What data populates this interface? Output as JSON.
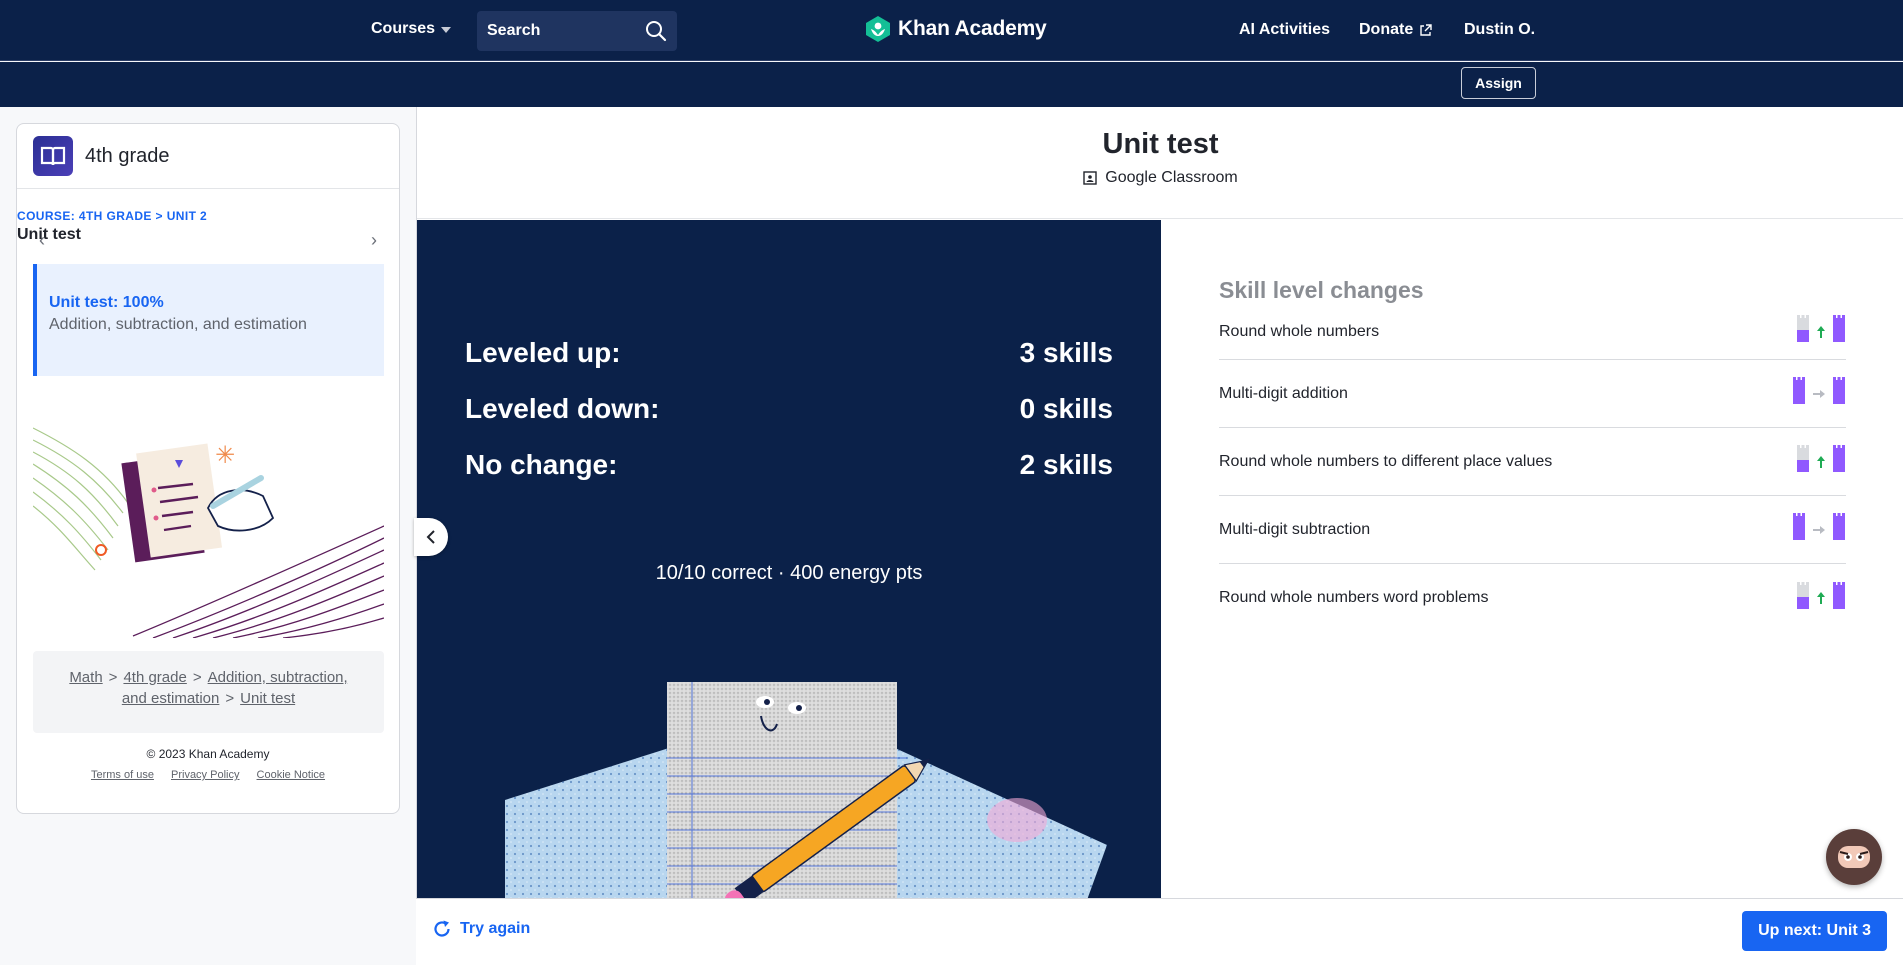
{
  "nav": {
    "courses_label": "Courses",
    "search_placeholder": "Search",
    "logo_text": "Khan Academy",
    "ai_label": "AI Activities",
    "donate_label": "Donate",
    "user_label": "Dustin O.",
    "assign_label": "Assign"
  },
  "sidebar": {
    "course_title": "4th grade",
    "crumb_course": "COURSE: 4TH GRADE",
    "crumb_sep": ">",
    "crumb_unit": "UNIT 2",
    "unit_name": "Unit test",
    "active_item": {
      "title": "Unit test: 100%",
      "subtitle": "Addition, subtraction, and estimation"
    },
    "breadcrumb": [
      "Math",
      "4th grade",
      "Addition, subtraction,",
      "and estimation",
      "Unit test"
    ],
    "breadcrumb_sep": ">",
    "copyright": "© 2023 Khan Academy",
    "footer_links": [
      "Terms of use",
      "Privacy Policy",
      "Cookie Notice"
    ]
  },
  "main": {
    "title": "Unit test",
    "google_classroom": "Google Classroom",
    "stats": [
      {
        "label": "Leveled up:",
        "value": "3 skills"
      },
      {
        "label": "Leveled down:",
        "value": "0 skills"
      },
      {
        "label": "No change:",
        "value": "2 skills"
      }
    ],
    "summary": "10/10 correct · 400 energy pts",
    "skills_title": "Skill level changes",
    "skills": [
      {
        "name": "Round whole numbers",
        "change": "up"
      },
      {
        "name": "Multi-digit addition",
        "change": "same"
      },
      {
        "name": "Round whole numbers to different place values",
        "change": "up"
      },
      {
        "name": "Multi-digit subtraction",
        "change": "same"
      },
      {
        "name": "Round whole numbers word problems",
        "change": "up"
      }
    ]
  },
  "bottom": {
    "try_again": "Try again",
    "next_label": "Up next: Unit 3"
  },
  "colors": {
    "nav_bg": "#0b2149",
    "accent": "#1865f2",
    "skill_purple": "#9059ff",
    "level_up_green": "#1fab54"
  }
}
